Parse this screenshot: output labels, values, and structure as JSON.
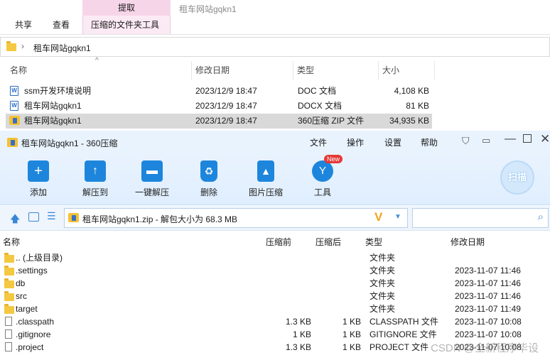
{
  "ribbon": {
    "context_tab": "提取",
    "tabs": [
      "共享",
      "查看",
      "压缩的文件夹工具"
    ],
    "window_title": "租车网站gqkn1"
  },
  "explorer": {
    "breadcrumb": "租车网站gqkn1",
    "columns": [
      "名称",
      "修改日期",
      "类型",
      "大小"
    ],
    "files": [
      {
        "name": "ssm开发环境说明",
        "date": "2023/12/9 18:47",
        "type": "DOC 文档",
        "size": "4,108 KB",
        "icon": "word-doc-icon"
      },
      {
        "name": "租车网站gqkn1",
        "date": "2023/12/9 18:47",
        "type": "DOCX 文档",
        "size": "81 KB",
        "icon": "word-docx-icon"
      },
      {
        "name": "租车网站gqkn1",
        "date": "2023/12/9 18:47",
        "type": "360压缩 ZIP 文件",
        "size": "34,935 KB",
        "icon": "zip-icon"
      }
    ]
  },
  "zip_window": {
    "title": "租车网站gqkn1 - 360压缩",
    "menu": [
      "文件",
      "操作",
      "设置",
      "帮助"
    ],
    "toolbar": [
      {
        "label": "添加",
        "icon": "add-icon"
      },
      {
        "label": "解压到",
        "icon": "extract-to-icon"
      },
      {
        "label": "一键解压",
        "icon": "one-click-extract-icon"
      },
      {
        "label": "删除",
        "icon": "delete-icon"
      },
      {
        "label": "图片压缩",
        "icon": "image-compress-icon"
      },
      {
        "label": "工具",
        "icon": "tools-icon"
      }
    ],
    "tools_badge": "New",
    "scan_label": "扫描",
    "path": "租车网站gqkn1.zip - 解包大小为 68.3 MB",
    "columns": [
      "名称",
      "压缩前",
      "压缩后",
      "类型",
      "修改日期"
    ],
    "entries": [
      {
        "name": ".. (上级目录)",
        "before": "",
        "after": "",
        "type": "文件夹",
        "date": "",
        "kind": "folder"
      },
      {
        "name": ".settings",
        "before": "",
        "after": "",
        "type": "文件夹",
        "date": "2023-11-07 11:46",
        "kind": "folder"
      },
      {
        "name": "db",
        "before": "",
        "after": "",
        "type": "文件夹",
        "date": "2023-11-07 11:46",
        "kind": "folder"
      },
      {
        "name": "src",
        "before": "",
        "after": "",
        "type": "文件夹",
        "date": "2023-11-07 11:46",
        "kind": "folder"
      },
      {
        "name": "target",
        "before": "",
        "after": "",
        "type": "文件夹",
        "date": "2023-11-07 11:49",
        "kind": "folder"
      },
      {
        "name": ".classpath",
        "before": "1.3 KB",
        "after": "1 KB",
        "type": "CLASSPATH 文件",
        "date": "2023-11-07 10:08",
        "kind": "file"
      },
      {
        "name": ".gitignore",
        "before": "1 KB",
        "after": "1 KB",
        "type": "GITIGNORE 文件",
        "date": "2023-11-07 10:08",
        "kind": "file"
      },
      {
        "name": ".project",
        "before": "1.3 KB",
        "after": "1 KB",
        "type": "PROJECT 文件",
        "date": "2023-11-07 10:08",
        "kind": "file"
      }
    ]
  },
  "watermark": "CSDN @全新程序毕设",
  "colors": {
    "accent": "#1e88e5",
    "ribbon_context": "#f7d5e8",
    "zip_title_bg": "#e9f3fe",
    "selection": "#d9d9d9"
  }
}
